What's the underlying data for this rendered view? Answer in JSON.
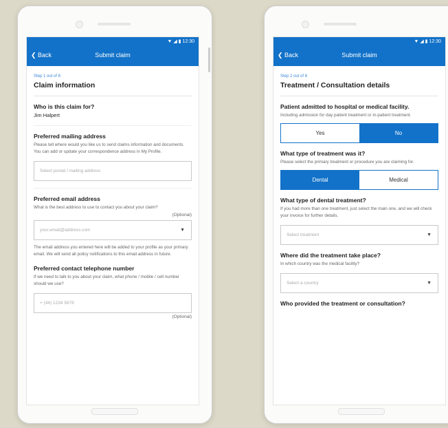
{
  "common": {
    "status_time": "▼ ◢ ▮ 12:30",
    "back_label": "❮ Back",
    "app_title": "Submit claim"
  },
  "screen1": {
    "step": "Step 1 out of 6",
    "heading": "Claim information",
    "who_label": "Who is this claim for?",
    "who_value": "Jim Halpert",
    "mailing_label": "Preferred mailing address",
    "mailing_help": "Please tell where would you like us to send claims information and documents. You can add or update your correspondence address in My Profile.",
    "mailing_placeholder": "Select postal / mailing address",
    "email_label": "Preferred email address",
    "email_help": "What is the best address to use to contact you about your claim?",
    "email_optional": "(Optional)",
    "email_placeholder": "your.email@address.com",
    "email_note": "The email address you entered here will be added to your profile as your primary email. We will send all policy notifications to this email address in future.",
    "phone_label": "Preferred contact telephone number",
    "phone_help": "If we need to talk to you about your claim, what phone / mobile / cell number should we use?",
    "phone_placeholder": "+ (44) 1234 5678",
    "phone_optional": "(Optional)"
  },
  "screen2": {
    "step": "Step 2 out of 6",
    "heading": "Treatment / Consultation details",
    "admitted_label": "Patient admitted to hospital or medical facility.",
    "admitted_help": "Including admission for day patient treatment or in-patient treatment.",
    "yes_label": "Yes",
    "no_label": "No",
    "type_label": "What type of treatment was it?",
    "type_help": "Please select the primary treatment or procedure you are claiming for.",
    "dental_label": "Dental",
    "medical_label": "Medical",
    "dental_type_label": "What type of dental treatment?",
    "dental_type_help": "If you had more than one treatment, just select the main one, and we will check your invoice for further details.",
    "dental_placeholder": "Select treatment",
    "where_label": "Where did the treatment take place?",
    "where_help": "In which country was the medical facility?",
    "country_placeholder": "Select a country",
    "who_provided_label": "Who provided the treatment or consultation?"
  }
}
